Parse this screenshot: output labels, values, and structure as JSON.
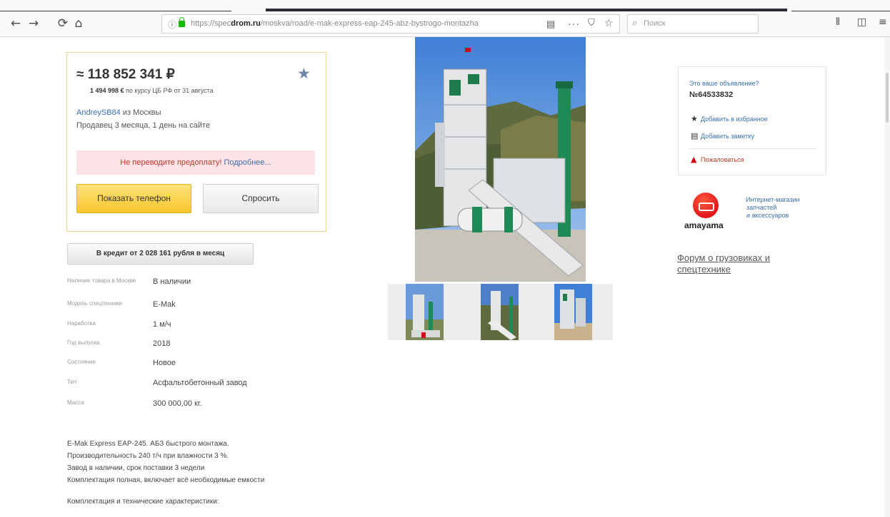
{
  "browser": {
    "nav": {
      "back_icon": "←",
      "forward_icon": "→",
      "reload_icon": "⟳",
      "home_icon": "⌂"
    },
    "url_prefix": "https://spec",
    "url_domain": "drom.ru",
    "url_path": "/moskva/road/e-mak-express-eap-245-abz-bystrogo-montazha",
    "search_placeholder": "Поиск"
  },
  "listing": {
    "price": "≈ 118 852 341 ₽",
    "price_eur": "1 494 998 €",
    "price_eur_note": "по курсу ЦБ РФ от 31 августа",
    "seller_name": "AndreySB84",
    "seller_city": "из Москвы",
    "seller_since": "Продавец 3 месяца, 1 день на сайте",
    "warning_text": "Не переводите предоплату!",
    "warning_link": "Подробнее...",
    "show_phone": "Показать телефон",
    "ask": "Спросить",
    "credit": "В кредит от 2 028 161 рубля в месяц"
  },
  "specs": [
    {
      "key": "Наличие товара в Москве",
      "value": "В наличии"
    },
    {
      "key": "Модель спецтехники",
      "value": "E-Mak"
    },
    {
      "key": "Наработка",
      "value": "1 м/ч"
    },
    {
      "key": "Год выпуска",
      "value": "2018"
    },
    {
      "key": "Состояние",
      "value": "Новое"
    },
    {
      "key": "Тип",
      "value": "Асфальтобетонный завод"
    },
    {
      "key": "Масса",
      "value": "300 000,00 кг."
    }
  ],
  "description": [
    "E-Mak Express EAP-245. АБЗ быстрого монтажа.",
    "Производительность 240 т/ч при влажности 3 %.",
    "Завод в наличии, срок поставки 3 недели",
    "Комплектация полная, включает всё необходимые емкости",
    "Комплектация и технические характеристики:"
  ],
  "owner": {
    "question": "Это ваше объявление?",
    "id": "№64533832",
    "add_fav": "Добавить в избранное",
    "add_note": "Добавить заметку",
    "complain": "Пожаловаться"
  },
  "amayama": {
    "name": "amayama",
    "line1": "Интернет-магазин",
    "line2": "запчастей",
    "line3": "и аксессуаров"
  },
  "forum": {
    "line1": "Форум о грузовиках и",
    "line2": "спецтехнике"
  },
  "colors": {
    "link": "#3a6fb0",
    "price_border": "#f0d790",
    "phone_button": "#f6c72c",
    "warning_bg": "#fbe3e6"
  }
}
